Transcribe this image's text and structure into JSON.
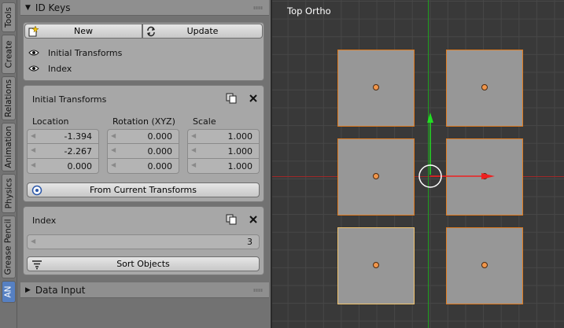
{
  "tabs": [
    "Tools",
    "Create",
    "Relations",
    "Animation",
    "Physics",
    "Grease Pencil",
    "AN"
  ],
  "id_keys": {
    "title": "ID Keys",
    "new_label": "New",
    "update_label": "Update",
    "keys": [
      "Initial Transforms",
      "Index"
    ]
  },
  "initial_transforms": {
    "title": "Initial Transforms",
    "location_label": "Location",
    "rotation_label": "Rotation (XYZ)",
    "scale_label": "Scale",
    "location": [
      "-1.394",
      "-2.267",
      "0.000"
    ],
    "rotation": [
      "0.000",
      "0.000",
      "0.000"
    ],
    "scale": [
      "1.000",
      "1.000",
      "1.000"
    ],
    "from_current_label": "From Current Transforms"
  },
  "index_panel": {
    "title": "Index",
    "value": "3",
    "sort_label": "Sort Objects"
  },
  "data_input": {
    "title": "Data Input"
  },
  "viewport": {
    "title": "Top Ortho"
  },
  "colors": {
    "active_tab": "#5680c2",
    "selection_outline": "#e07b1f",
    "active_outline": "#f3c56f",
    "x_axis": "#d02020",
    "y_axis": "#20c020"
  }
}
